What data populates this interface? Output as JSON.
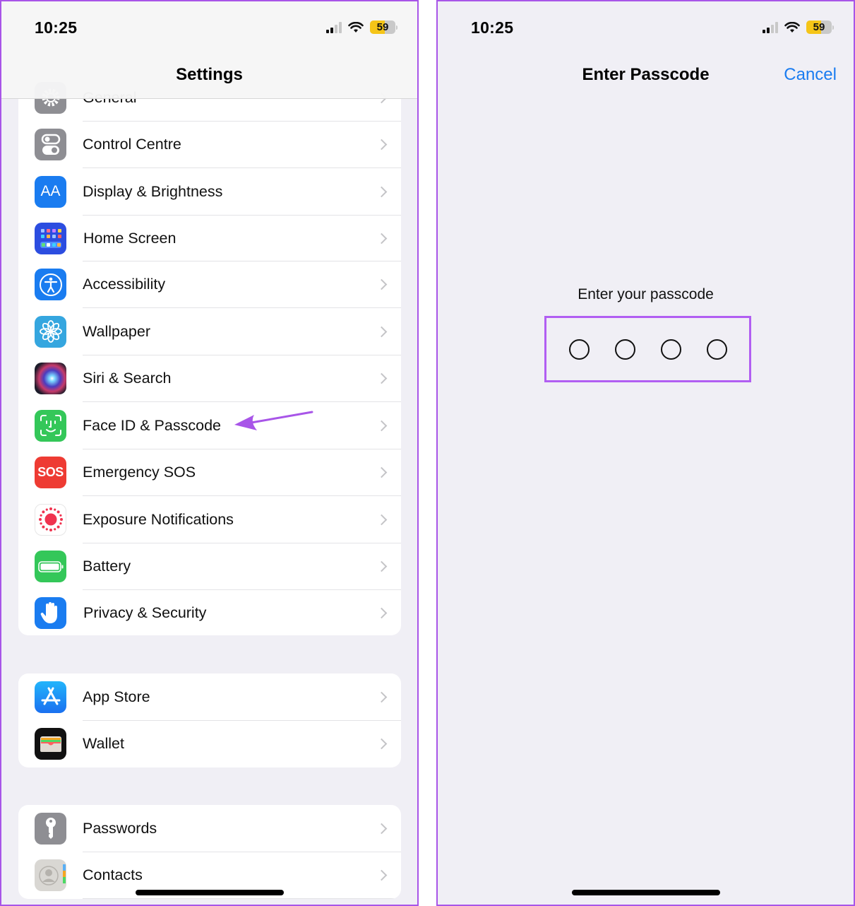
{
  "left_screen": {
    "status_bar": {
      "time": "10:25",
      "battery_percent": "59",
      "battery_level": 0.59,
      "signal_bars_active": 2,
      "signal_bars_total": 4
    },
    "nav": {
      "title": "Settings"
    },
    "partial_row": {
      "label": "General",
      "icon": "gear-icon"
    },
    "groups": [
      {
        "items": [
          {
            "label": "Control Centre",
            "icon": "control-centre-icon",
            "color": "#8e8e93"
          },
          {
            "label": "Display & Brightness",
            "icon": "display-brightness-icon",
            "color": "#1a7cf0",
            "glyph": "AA"
          },
          {
            "label": "Home Screen",
            "icon": "home-screen-icon",
            "color": "#2c4de0"
          },
          {
            "label": "Accessibility",
            "icon": "accessibility-icon",
            "color": "#1a7cf0"
          },
          {
            "label": "Wallpaper",
            "icon": "wallpaper-icon",
            "color": "#35a6df"
          },
          {
            "label": "Siri & Search",
            "icon": "siri-icon",
            "color": "#1c1c2a"
          },
          {
            "label": "Face ID & Passcode",
            "icon": "face-id-icon",
            "color": "#34c759"
          },
          {
            "label": "Emergency SOS",
            "icon": "sos-icon",
            "color": "#ee3b33",
            "glyph": "SOS"
          },
          {
            "label": "Exposure Notifications",
            "icon": "exposure-notifications-icon",
            "color": "#ffffff"
          },
          {
            "label": "Battery",
            "icon": "battery-icon",
            "color": "#34c759"
          },
          {
            "label": "Privacy & Security",
            "icon": "privacy-hand-icon",
            "color": "#1a7cf0"
          }
        ]
      },
      {
        "items": [
          {
            "label": "App Store",
            "icon": "app-store-icon",
            "color": "#1a8cf5"
          },
          {
            "label": "Wallet",
            "icon": "wallet-icon",
            "color": "#111111"
          }
        ]
      },
      {
        "items": [
          {
            "label": "Passwords",
            "icon": "key-icon",
            "color": "#8e8e93"
          },
          {
            "label": "Contacts",
            "icon": "contacts-icon",
            "color": "#d9d9d9"
          }
        ]
      }
    ],
    "annotation": {
      "points_to": "Face ID & Passcode",
      "color": "#a855e8"
    }
  },
  "right_screen": {
    "status_bar": {
      "time": "10:25",
      "battery_percent": "59",
      "battery_level": 0.59,
      "signal_bars_active": 2,
      "signal_bars_total": 4
    },
    "nav": {
      "title": "Enter Passcode",
      "cancel_label": "Cancel"
    },
    "prompt": "Enter your passcode",
    "passcode_length": 4,
    "digits_entered": 0,
    "highlight_color": "#b15ef2",
    "accent_color": "#1a7cf0"
  }
}
